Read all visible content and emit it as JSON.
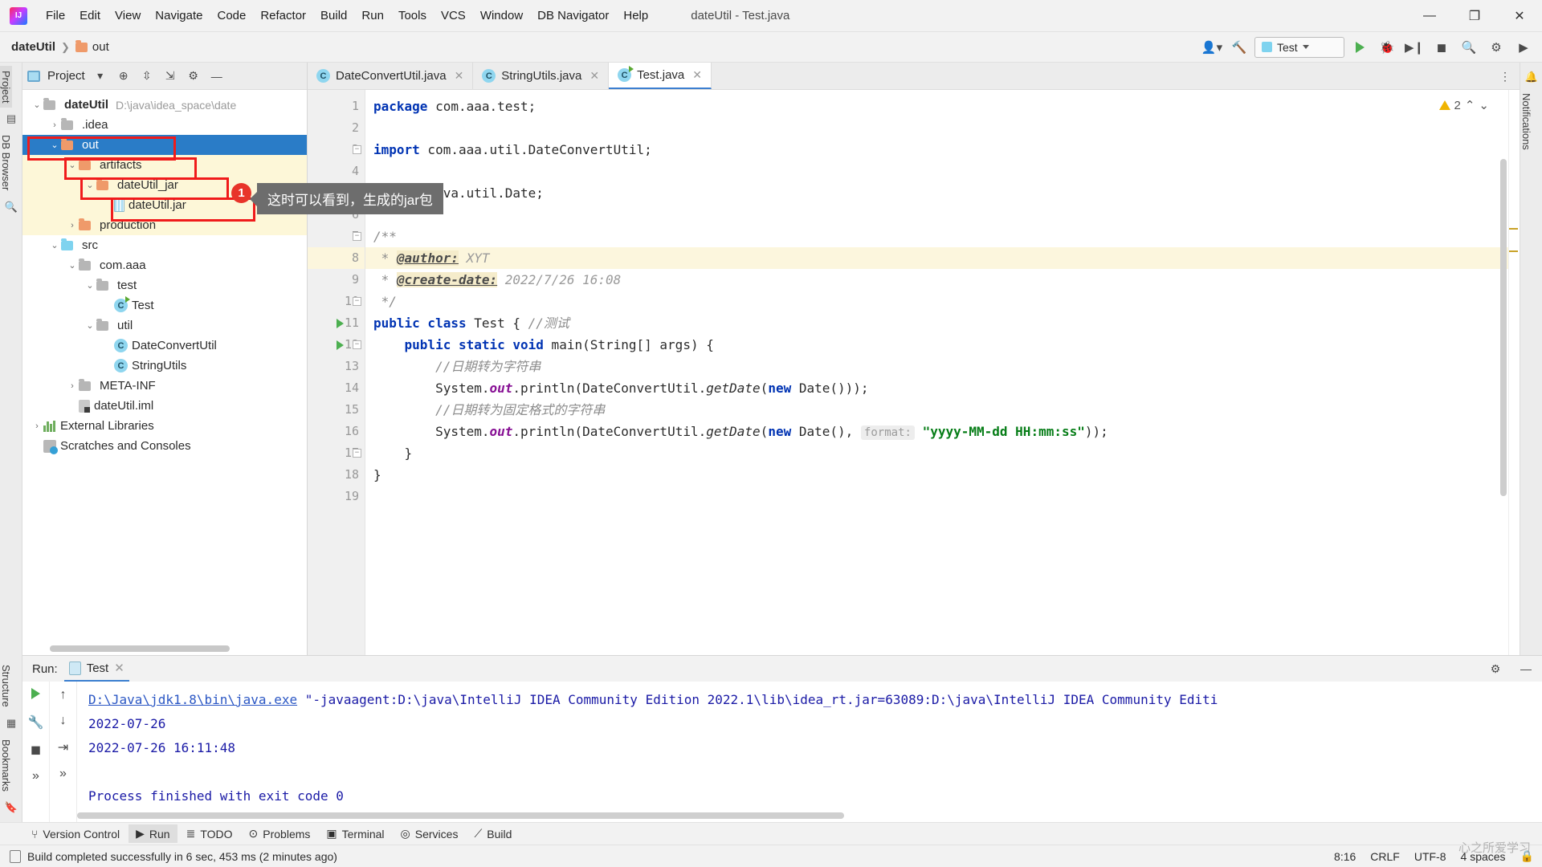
{
  "window": {
    "title": "dateUtil - Test.java",
    "minimize": "—",
    "maximize": "❐",
    "close": "✕"
  },
  "menu": {
    "items": [
      "File",
      "Edit",
      "View",
      "Navigate",
      "Code",
      "Refactor",
      "Build",
      "Run",
      "Tools",
      "VCS",
      "Window",
      "DB Navigator",
      "Help"
    ]
  },
  "navbar": {
    "project": "dateUtil",
    "crumb_out": "out",
    "run_config": "Test",
    "icons": [
      "user-icon",
      "hammer-icon",
      "run-icon",
      "debug-icon",
      "run-coverage-icon",
      "stop-icon",
      "search-icon",
      "settings-icon",
      "updates-icon"
    ]
  },
  "left_strip": {
    "top": [
      "Project"
    ],
    "side": [
      "DB Browser"
    ],
    "bottom": [
      "Structure",
      "Bookmarks"
    ]
  },
  "right_strip": {
    "labels": [
      "Notifications"
    ]
  },
  "project_panel": {
    "title": "Project",
    "header_icons": [
      "chevron-down-icon",
      "locate-icon",
      "expand-all-icon",
      "collapse-all-icon",
      "gear-icon",
      "hide-icon"
    ],
    "tree": [
      {
        "label": "dateUtil",
        "sub": "D:\\java\\idea_space\\date",
        "depth": 0,
        "arrow": "v",
        "icon": "module-folder",
        "bold": true
      },
      {
        "label": ".idea",
        "sub": "",
        "depth": 1,
        "arrow": ">",
        "icon": "folder-gray"
      },
      {
        "label": "out",
        "sub": "",
        "depth": 1,
        "arrow": "v",
        "icon": "folder-orange",
        "selected": true
      },
      {
        "label": "artifacts",
        "sub": "",
        "depth": 2,
        "arrow": "v",
        "icon": "folder-orange",
        "highlight": true
      },
      {
        "label": "dateUtil_jar",
        "sub": "",
        "depth": 3,
        "arrow": "v",
        "icon": "folder-orange",
        "highlight": true
      },
      {
        "label": "dateUtil.jar",
        "sub": "",
        "depth": 4,
        "arrow": "",
        "icon": "jar",
        "highlight": true
      },
      {
        "label": "production",
        "sub": "",
        "depth": 2,
        "arrow": ">",
        "icon": "folder-orange",
        "highlight": true
      },
      {
        "label": "src",
        "sub": "",
        "depth": 1,
        "arrow": "v",
        "icon": "folder-blue"
      },
      {
        "label": "com.aaa",
        "sub": "",
        "depth": 2,
        "arrow": "v",
        "icon": "package"
      },
      {
        "label": "test",
        "sub": "",
        "depth": 3,
        "arrow": "v",
        "icon": "package"
      },
      {
        "label": "Test",
        "sub": "",
        "depth": 4,
        "arrow": "",
        "icon": "class-runnable"
      },
      {
        "label": "util",
        "sub": "",
        "depth": 3,
        "arrow": "v",
        "icon": "package"
      },
      {
        "label": "DateConvertUtil",
        "sub": "",
        "depth": 4,
        "arrow": "",
        "icon": "class"
      },
      {
        "label": "StringUtils",
        "sub": "",
        "depth": 4,
        "arrow": "",
        "icon": "class"
      },
      {
        "label": "META-INF",
        "sub": "",
        "depth": 2,
        "arrow": ">",
        "icon": "folder-gray"
      },
      {
        "label": "dateUtil.iml",
        "sub": "",
        "depth": 2,
        "arrow": "",
        "icon": "iml"
      },
      {
        "label": "External Libraries",
        "sub": "",
        "depth": 0,
        "arrow": ">",
        "icon": "libraries"
      },
      {
        "label": "Scratches and Consoles",
        "sub": "",
        "depth": 0,
        "arrow": "",
        "icon": "scratches"
      }
    ]
  },
  "annotation": {
    "badge": "1",
    "tooltip": "这时可以看到，生成的jar包",
    "box_color": "#f01b1b"
  },
  "editor": {
    "tabs": [
      {
        "label": "DateConvertUtil.java",
        "active": false,
        "close": "✕"
      },
      {
        "label": "StringUtils.java",
        "active": false,
        "close": "✕"
      },
      {
        "label": "Test.java",
        "active": true,
        "close": "✕"
      }
    ],
    "warning_count": "2",
    "more_icon": "more-vertical-icon",
    "lines": [
      {
        "no": "1",
        "html": "<span class=\"kw\">package</span> com.aaa.test;"
      },
      {
        "no": "2",
        "html": ""
      },
      {
        "no": "3",
        "html": "<span class=\"kw\">import</span> com.aaa.util.DateConvertUtil;",
        "fold": true
      },
      {
        "no": "4",
        "html": ""
      },
      {
        "no": "5",
        "html": "<span class=\"kw\">import</span> java.util.Date;",
        "fold": true
      },
      {
        "no": "6",
        "html": ""
      },
      {
        "no": "7",
        "html": "<span class=\"cmt\">/**</span>",
        "fold": true
      },
      {
        "no": "8",
        "html": "<span class=\"cmt\"> * </span><span class=\"doctag\">@author:</span><span class=\"docval\"> XYT</span>",
        "hl": true
      },
      {
        "no": "9",
        "html": "<span class=\"cmt\"> * </span><span class=\"doctag\">@create-date:</span><span class=\"docval\"> 2022/7/26 16:08</span>"
      },
      {
        "no": "10",
        "html": "<span class=\"cmt\"> */</span>",
        "fold": true
      },
      {
        "no": "11",
        "html": "<span class=\"kw\">public class</span> Test { <span class=\"cmt\">//测试</span>",
        "run": true
      },
      {
        "no": "12",
        "html": "    <span class=\"kw\">public static void</span> main(String[] args) {",
        "run": true,
        "fold": true
      },
      {
        "no": "13",
        "html": "        <span class=\"cmt\">//日期转为字符串</span>"
      },
      {
        "no": "14",
        "html": "        System.<span class=\"fld\">out</span>.println(DateConvertUtil.<span class=\"mth\">getDate</span>(<span class=\"kw\">new</span> Date()));"
      },
      {
        "no": "15",
        "html": "        <span class=\"cmt\">//日期转为固定格式的字符串</span>"
      },
      {
        "no": "16",
        "html": "        System.<span class=\"fld\">out</span>.println(DateConvertUtil.<span class=\"mth\">getDate</span>(<span class=\"kw\">new</span> Date(), <span class=\"hint\">format:</span> <span class=\"str\">\"yyyy-MM-dd HH:mm:ss\"</span>));"
      },
      {
        "no": "17",
        "html": "    }",
        "fold": true
      },
      {
        "no": "18",
        "html": "}"
      },
      {
        "no": "19",
        "html": ""
      }
    ]
  },
  "run_window": {
    "label": "Run:",
    "tab": "Test",
    "tab_close": "✕",
    "toolbar_icons": [
      "run-icon",
      "wrench-icon",
      "stop-icon",
      "expand-icon"
    ],
    "nav_icons": [
      "up-arrow-icon",
      "down-arrow-icon",
      "soft-wrap-icon"
    ],
    "settings_icon": "gear-icon",
    "hide_icon": "minimize-icon",
    "console": [
      {
        "type": "cmd",
        "link": "D:\\Java\\jdk1.8\\bin\\java.exe",
        "rest": " \"-javaagent:D:\\java\\IntelliJ IDEA Community Edition 2022.1\\lib\\idea_rt.jar=63089:D:\\java\\IntelliJ IDEA Community Editi"
      },
      {
        "type": "out",
        "text": "2022-07-26"
      },
      {
        "type": "out",
        "text": "2022-07-26 16:11:48"
      },
      {
        "type": "blank",
        "text": ""
      },
      {
        "type": "out",
        "text": "Process finished with exit code 0"
      }
    ]
  },
  "bottom_tabs": [
    {
      "label": "Version Control",
      "icon": "branch-icon",
      "active": false
    },
    {
      "label": "Run",
      "icon": "run-icon",
      "active": true
    },
    {
      "label": "TODO",
      "icon": "todo-icon",
      "active": false
    },
    {
      "label": "Problems",
      "icon": "problems-icon",
      "active": false
    },
    {
      "label": "Terminal",
      "icon": "terminal-icon",
      "active": false
    },
    {
      "label": "Services",
      "icon": "services-icon",
      "active": false
    },
    {
      "label": "Build",
      "icon": "build-icon",
      "active": false
    }
  ],
  "statusbar": {
    "message": "Build completed successfully in 6 sec, 453 ms (2 minutes ago)",
    "caret": "8:16",
    "line_sep": "CRLF",
    "encoding": "UTF-8",
    "indent": "4 spaces",
    "lock_icon": "lock-icon"
  },
  "watermark": "心之所爱学习"
}
